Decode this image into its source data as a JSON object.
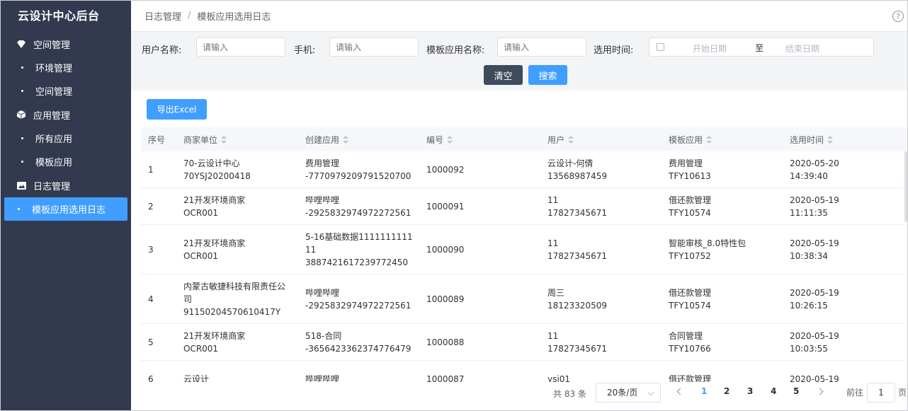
{
  "sidebar": {
    "title": "云设计中心后台",
    "groups": [
      {
        "label": "空间管理",
        "icon": "gem-icon"
      },
      {
        "label": "应用管理",
        "icon": "cube-icon"
      },
      {
        "label": "日志管理",
        "icon": "image-icon"
      }
    ],
    "items": [
      {
        "label": "环境管理"
      },
      {
        "label": "空间管理"
      },
      {
        "label": "所有应用"
      },
      {
        "label": "模板应用"
      },
      {
        "label": "模板应用选用日志",
        "active": true
      }
    ]
  },
  "header": {
    "breadcrumb": [
      "日志管理",
      "模板应用选用日志"
    ],
    "separator": "/",
    "help_icon": "?"
  },
  "filters": {
    "username_label": "用户名称:",
    "username_placeholder": "请输入",
    "phone_label": "手机:",
    "phone_placeholder": "请输入",
    "template_label": "模板应用名称:",
    "template_placeholder": "请输入",
    "time_label": "选用时间:",
    "start_placeholder": "开始日期",
    "range_sep": "至",
    "end_placeholder": "结束日期",
    "clear_label": "清空",
    "search_label": "搜索"
  },
  "export_label": "导出Excel",
  "table": {
    "columns": [
      "序号",
      "商家单位",
      "创建应用",
      "编号",
      "用户",
      "模板应用",
      "选用时间"
    ],
    "rows": [
      {
        "idx": "1",
        "merchant": [
          "70-云设计中心",
          "70YSJ20200418"
        ],
        "app": [
          "费用管理",
          "-7770979209791520700"
        ],
        "code": "1000092",
        "user": [
          "云设计-何倩",
          "13568987459"
        ],
        "template": [
          "费用管理",
          "TFY10613"
        ],
        "time": [
          "2020-05-20",
          "14:39:40"
        ],
        "h": 52
      },
      {
        "idx": "2",
        "merchant": [
          "21开发环境商家",
          "OCR001"
        ],
        "app": [
          "哔哩哔哩",
          "-2925832974972272561"
        ],
        "code": "1000091",
        "user": [
          "11",
          "17827345671"
        ],
        "template": [
          "借还款管理",
          "TFY10574"
        ],
        "time": [
          "2020-05-19",
          "11:11:35"
        ],
        "h": 52
      },
      {
        "idx": "3",
        "merchant": [
          "21开发环境商家",
          "OCR001"
        ],
        "app": [
          "5-16基础数据1111111111",
          "11",
          "3887421617239772450"
        ],
        "code": "1000090",
        "user": [
          "11",
          "17827345671"
        ],
        "template": [
          "智能审核_8.0特性包",
          "TFY10752"
        ],
        "time": [
          "2020-05-19",
          "10:38:34"
        ],
        "h": 70
      },
      {
        "idx": "4",
        "merchant": [
          "内蒙古敏捷科技有限责任公",
          "司",
          "91150204570610417Y"
        ],
        "app": [
          "哔哩哔哩",
          "-2925832974972272561"
        ],
        "code": "1000089",
        "user": [
          "周三",
          "18123320509"
        ],
        "template": [
          "借还款管理",
          "TFY10574"
        ],
        "time": [
          "2020-05-19",
          "10:26:15"
        ],
        "h": 70
      },
      {
        "idx": "5",
        "merchant": [
          "21开发环境商家",
          "OCR001"
        ],
        "app": [
          "518-合同",
          "-3656423362374776479"
        ],
        "code": "1000088",
        "user": [
          "11",
          "17827345671"
        ],
        "template": [
          "合同管理",
          "TFY10766"
        ],
        "time": [
          "2020-05-19",
          "10:03:55"
        ],
        "h": 52
      },
      {
        "idx": "6",
        "merchant": [
          "云设计",
          ""
        ],
        "app": [
          "哔哩哔哩",
          ""
        ],
        "code": "1000087",
        "user": [
          "ysj01",
          ""
        ],
        "template": [
          "借还款管理",
          ""
        ],
        "time": [
          "2020-05-19",
          ""
        ],
        "h": 52
      }
    ]
  },
  "pagination": {
    "total_text": "共 83 条",
    "page_size": "20条/页",
    "pages": [
      "1",
      "2",
      "3",
      "4",
      "5"
    ],
    "current": "1",
    "goto_label": "前往",
    "goto_value": "1",
    "page_unit": "页"
  },
  "colors": {
    "sidebar_bg": "#333a4f",
    "primary": "#409eff",
    "clear_button": "#3d4b5c"
  }
}
